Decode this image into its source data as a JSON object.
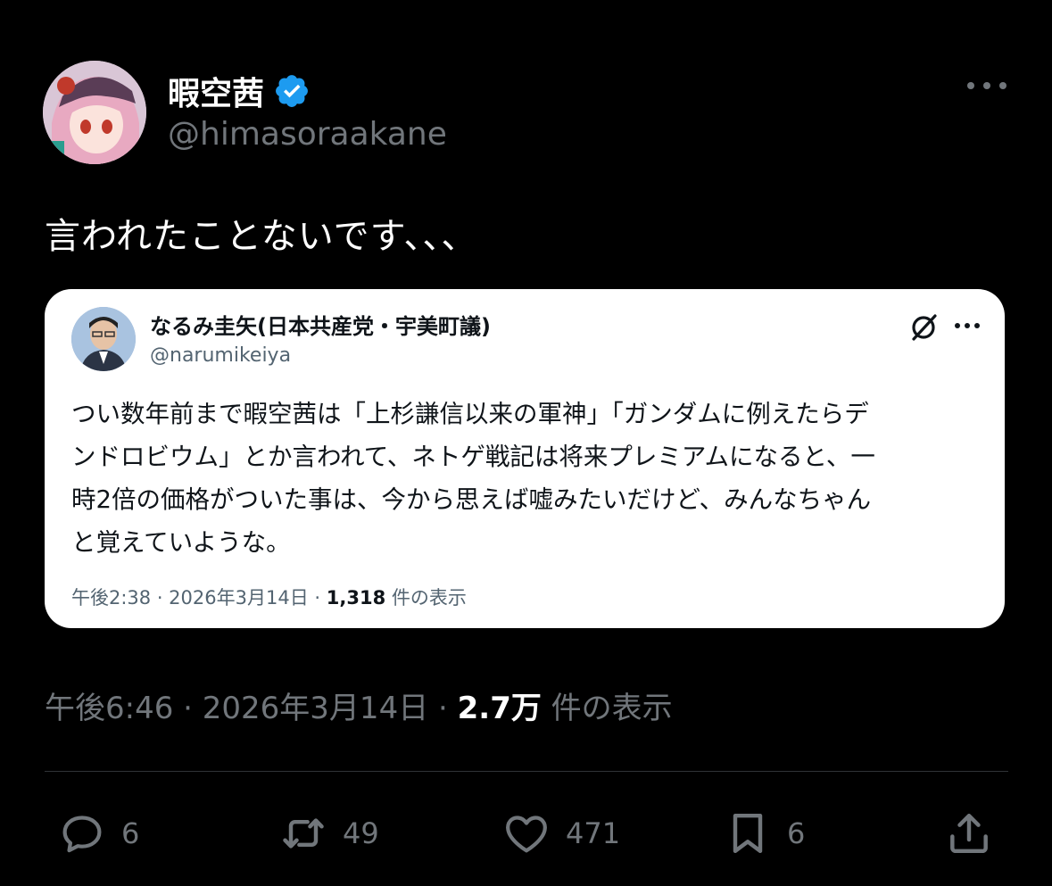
{
  "author": {
    "display_name": "暇空茜",
    "handle": "@himasoraakane"
  },
  "tweet": {
    "text": "言われたことないです、、、"
  },
  "quoted": {
    "author_name": "なるみ圭矢(日本共産党・宇美町議)",
    "author_handle": "@narumikeiya",
    "text_lines": [
      "つい数年前まで暇空茜は「上杉謙信以来の軍神」「ガンダムに例えたらデ",
      "ンドロビウム」とか言われて、ネトゲ戦記は将来プレミアムになると、一",
      "時2倍の価格がついた事は、今から思えば嘘みたいだけど、みんなちゃん",
      "と覚えていような。"
    ],
    "meta_time": "午後2:38 · 2026年3月14日 · ",
    "meta_views": "1,318",
    "meta_views_label": " 件の表示"
  },
  "meta": {
    "time": "午後6:46 · 2026年3月14日 · ",
    "views": "2.7万",
    "views_label": " 件の表示"
  },
  "actions": {
    "reply": "6",
    "retweet": "49",
    "like": "471",
    "bookmark": "6"
  },
  "colors": {
    "background": "#000000",
    "verified": "#1d9bf0",
    "muted": "#71767b"
  }
}
